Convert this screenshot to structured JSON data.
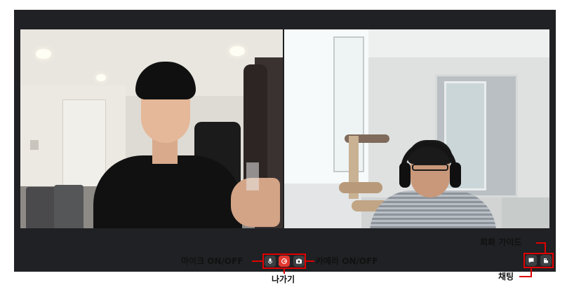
{
  "controls": {
    "mic_toggle": {
      "icon": "microphone-icon"
    },
    "leave": {
      "icon": "exit-icon"
    },
    "camera_toggle": {
      "icon": "camera-icon"
    },
    "chat": {
      "icon": "chat-bubble-icon"
    },
    "conversation_guide": {
      "icon": "guide-icon"
    }
  },
  "annotations": {
    "mic": "마이크 ON/OFF",
    "leave": "나가기",
    "camera": "카메라 ON/OFF",
    "guide": "회화 가이드",
    "chat": "채팅"
  },
  "colors": {
    "call_background": "#202124",
    "button_background": "#3c4043",
    "leave_button": "#e2372f",
    "annotation_red": "#e00000"
  }
}
